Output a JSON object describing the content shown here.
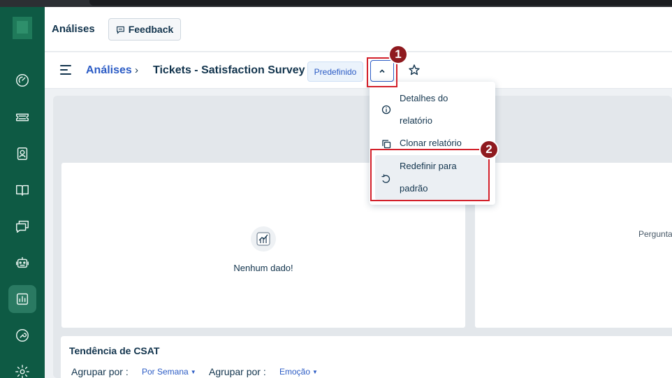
{
  "header": {
    "title": "Análises",
    "feedback_label": "Feedback"
  },
  "breadcrumb": {
    "parent": "Análises",
    "separator": "›",
    "current": "Tickets - Satisfaction Survey",
    "badge": "Predefinido"
  },
  "sidebar": {
    "items": [
      {
        "icon": "dashboard-icon"
      },
      {
        "icon": "ticket-icon"
      },
      {
        "icon": "contacts-icon"
      },
      {
        "icon": "book-icon"
      },
      {
        "icon": "chat-icon"
      },
      {
        "icon": "bot-icon"
      },
      {
        "icon": "analytics-icon",
        "active": true
      },
      {
        "icon": "wrench-icon"
      },
      {
        "icon": "gear-icon"
      }
    ]
  },
  "dropdown": {
    "items": [
      {
        "label": "Detalhes do relatório",
        "icon": "info-icon"
      },
      {
        "label": "Clonar relatório",
        "icon": "copy-icon"
      },
      {
        "label": "Redefinir para padrão",
        "icon": "reset-icon"
      }
    ]
  },
  "cards": {
    "no_data": "Nenhum dado!",
    "right_text": "Pergunta"
  },
  "csat": {
    "title": "Tendência de CSAT",
    "group_label_1": "Agrupar por :",
    "group_value_1": "Por Semana",
    "group_label_2": "Agrupar por :",
    "group_value_2": "Emoção"
  },
  "annotations": {
    "step1": "1",
    "step2": "2"
  },
  "colors": {
    "sidebar": "#0e5a44",
    "accent": "#2c5cc5",
    "highlight": "#d3202a",
    "badge": "#8f1a1f"
  }
}
